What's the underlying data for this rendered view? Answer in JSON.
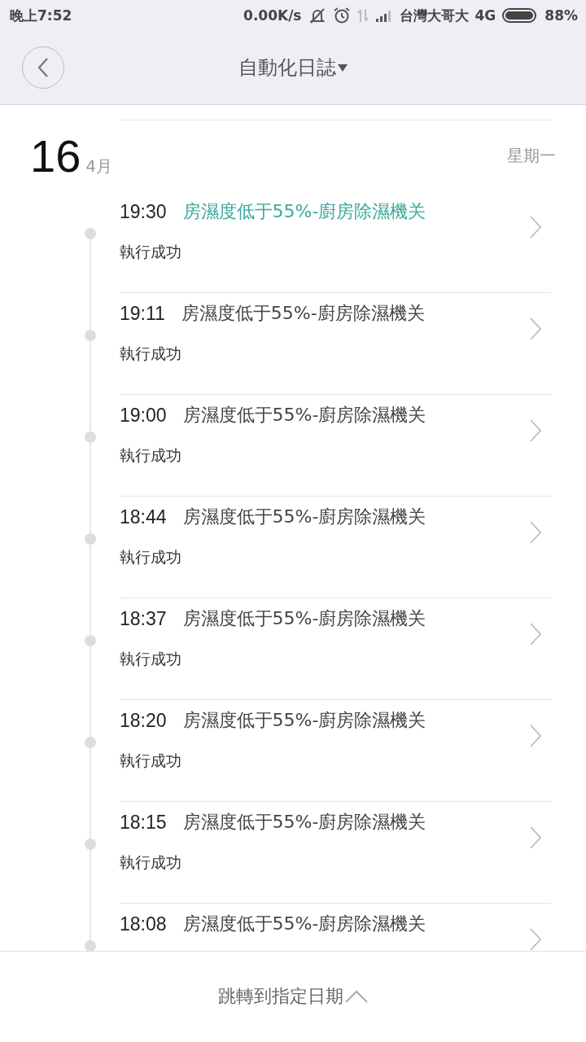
{
  "status_bar": {
    "time": "晚上7:52",
    "net_speed": "0.00K/s",
    "carrier": "台灣大哥大",
    "network": "4G",
    "battery": "88%"
  },
  "header": {
    "title": "自動化日誌"
  },
  "date": {
    "day": "16",
    "month": "4月",
    "weekday": "星期一"
  },
  "entries": [
    {
      "time": "19:30",
      "title": "房濕度低于55%-廚房除濕機关",
      "status": "執行成功",
      "highlighted": true
    },
    {
      "time": "19:11",
      "title": "房濕度低于55%-廚房除濕機关",
      "status": "執行成功",
      "highlighted": false
    },
    {
      "time": "19:00",
      "title": "房濕度低于55%-廚房除濕機关",
      "status": "執行成功",
      "highlighted": false
    },
    {
      "time": "18:44",
      "title": "房濕度低于55%-廚房除濕機关",
      "status": "執行成功",
      "highlighted": false
    },
    {
      "time": "18:37",
      "title": "房濕度低于55%-廚房除濕機关",
      "status": "執行成功",
      "highlighted": false
    },
    {
      "time": "18:20",
      "title": "房濕度低于55%-廚房除濕機关",
      "status": "執行成功",
      "highlighted": false
    },
    {
      "time": "18:15",
      "title": "房濕度低于55%-廚房除濕機关",
      "status": "執行成功",
      "highlighted": false
    },
    {
      "time": "18:08",
      "title": "房濕度低于55%-廚房除濕機关",
      "highlighted": false
    }
  ],
  "footer": {
    "label": "跳轉到指定日期"
  }
}
